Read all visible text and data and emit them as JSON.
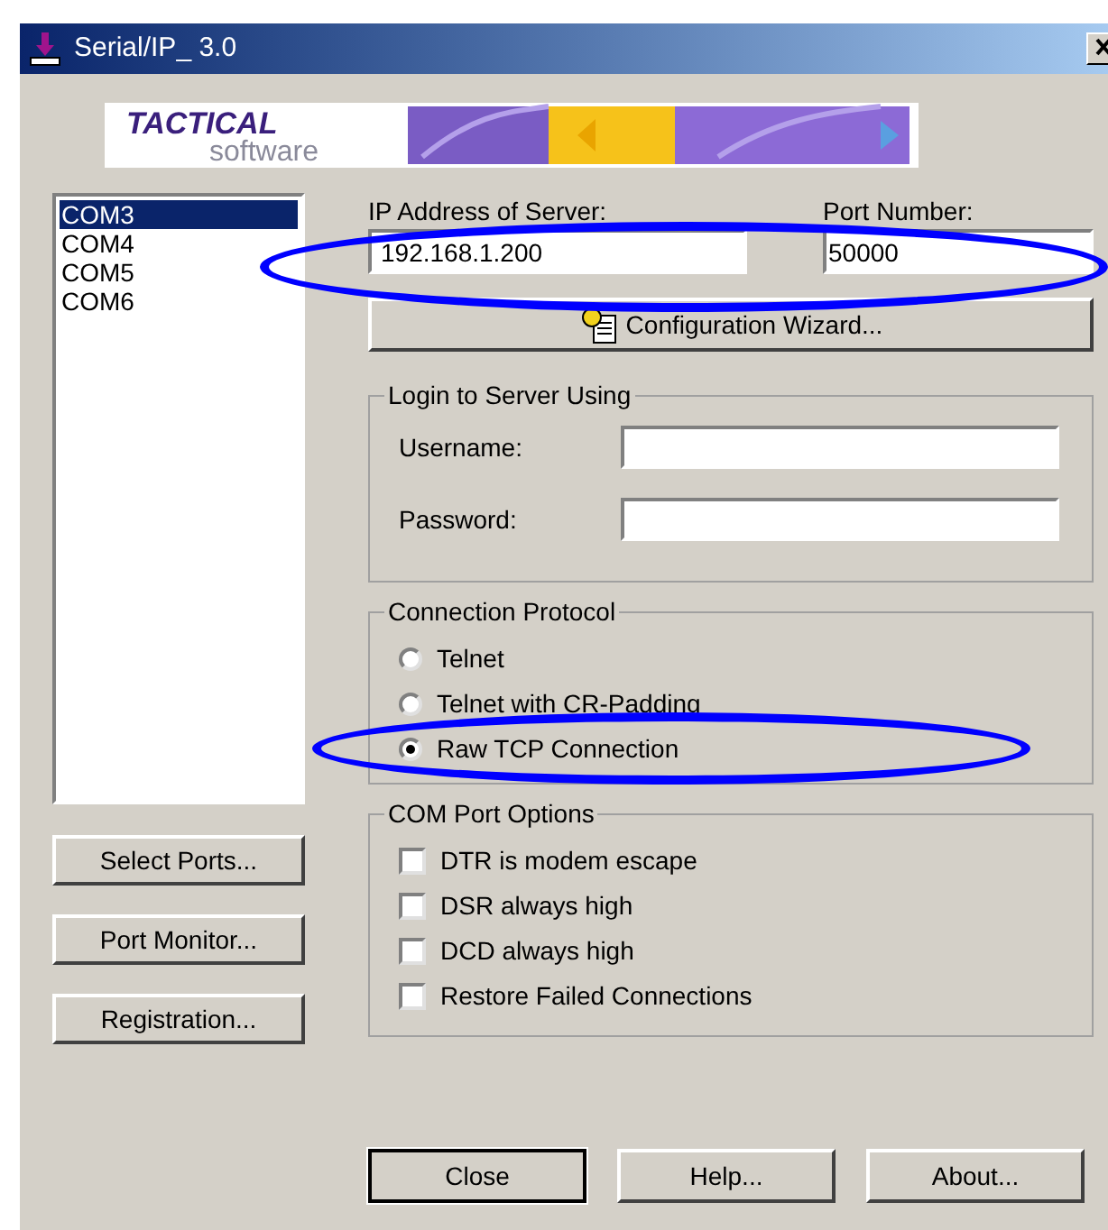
{
  "window": {
    "title": "Serial/IP_ 3.0"
  },
  "logo": {
    "line_1": "TACTICAL",
    "line_2": "software"
  },
  "ports": [
    {
      "label": "COM3",
      "selected": true
    },
    {
      "label": "COM4",
      "selected": false
    },
    {
      "label": "COM5",
      "selected": false
    },
    {
      "label": "COM6",
      "selected": false
    }
  ],
  "side_buttons": [
    "Select Ports...",
    "Port Monitor...",
    "Registration..."
  ],
  "server": {
    "ip_label": "IP Address of Server:",
    "ip_value": "192.168.1.200",
    "port_label": "Port Number:",
    "port_value": "50000",
    "highlighted": true
  },
  "wizard_button": "Configuration Wizard...",
  "login": {
    "title": "Login to Server Using",
    "fields": [
      {
        "label": "Username:"
      },
      {
        "label": "Password:"
      }
    ]
  },
  "protocol": {
    "title": "Connection Protocol",
    "options": [
      {
        "label": "Telnet",
        "selected": false,
        "highlighted": false
      },
      {
        "label": "Telnet with CR-Padding",
        "selected": false,
        "highlighted": false
      },
      {
        "label": "Raw TCP Connection",
        "selected": true,
        "highlighted": true
      }
    ]
  },
  "com_options": {
    "title": "COM Port Options",
    "items": [
      {
        "label": "DTR is modem escape",
        "checked": false
      },
      {
        "label": "DSR always high",
        "checked": false
      },
      {
        "label": "DCD always high",
        "checked": false
      },
      {
        "label": "Restore Failed Connections",
        "checked": false
      }
    ]
  },
  "buttons": [
    "Close",
    "Help...",
    "About..."
  ]
}
